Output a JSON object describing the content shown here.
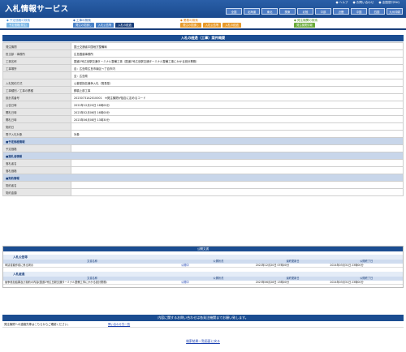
{
  "header": {
    "title": "入札情報サービス",
    "links": [
      "● ヘルプ",
      "● お問い合わせ",
      "● 全国窓口FAQ"
    ],
    "regions": [
      "全国",
      "北海道",
      "東北",
      "関東",
      "北陸",
      "中部",
      "近畿",
      "中国",
      "四国",
      "九州沖縄"
    ]
  },
  "nav": {
    "groups": [
      {
        "label": "◆ 予定価格の検索",
        "buttons": [
          "予定価格(発注)"
        ],
        "color": "#7bb7e6"
      },
      {
        "label": "◆ 工事の検索",
        "buttons": [
          "発注の見通し",
          "入札公告等",
          "入札の経過"
        ],
        "color": "#4a82c7"
      },
      {
        "label": "◆ 業務の検索",
        "buttons": [
          "発注の見通し",
          "入札公告等",
          "入札の経過"
        ],
        "color": "#e89a2a"
      },
      {
        "label": "◆ 発注機関の検索",
        "buttons": [
          "発注機関情報"
        ],
        "color": "#6aab3a"
      }
    ]
  },
  "page_title": "入札の経過（工事）案件概要",
  "info_rows": [
    {
      "label": "発注機関",
      "value": "国土交通省中国地方整備局"
    },
    {
      "label": "担当部・事務所",
      "value": "広島国道事務所"
    },
    {
      "label": "工事名称",
      "value": "国道2号広島駅交通ターミナル整備工事（国道2号広島駅交通ターミナル整備工事にかかる設計業務）"
    },
    {
      "label": "工事場所",
      "value": "自：広島県広島市南区～了自市内"
    },
    {
      "label": "",
      "value": "至：広島県"
    },
    {
      "label": "入札契約方式",
      "value": "公募型指名競争入札（簡易型）"
    },
    {
      "label": "工事種別／工事の業種",
      "value": "鋼橋上部工事"
    },
    {
      "label": "設計書番号",
      "value": "20230731A2010001　※発注機関が独自に定めるコード"
    },
    {
      "label": "公告日時",
      "value": "2022年12月20日 16時00分"
    },
    {
      "label": "開札日時",
      "value": "2023年02月06日 16時00分"
    },
    {
      "label": "開札日時",
      "value": "2023年06月08日 13時30分"
    },
    {
      "label": "契約日",
      "value": ""
    },
    {
      "label": "電子入札対象",
      "value": "対象"
    },
    {
      "label": "■予定価格情報",
      "value": "",
      "sub": true
    },
    {
      "label": "予定価格",
      "value": ""
    },
    {
      "label": "■落札者情報",
      "value": "",
      "sub": true
    },
    {
      "label": "落札者名",
      "value": ""
    },
    {
      "label": "落札価格",
      "value": ""
    },
    {
      "label": "■契約情報",
      "value": "",
      "sub": true
    },
    {
      "label": "契約者名",
      "value": ""
    },
    {
      "label": "契約金額",
      "value": ""
    }
  ],
  "docs": {
    "title": "公開文書",
    "sections": [
      {
        "title": "入札公告等",
        "columns": [
          "文書名称",
          "公開状況",
          "最終更新日",
          "公開終了日"
        ],
        "rows": [
          [
            "申請書類作成に係る掲示",
            "公開中",
            "2022年12月20日 07時00分",
            "2024年03月31日 23時00分"
          ]
        ]
      },
      {
        "title": "入札経過",
        "columns": [
          "文書名称",
          "公開状況",
          "最終更新日",
          "公開終了日"
        ],
        "rows": [
          [
            "競争参加結果及び契約の内容(国道2号広島駅交通ターミナル整備工事にかかる設計業務)",
            "公開中",
            "2023年06月28日 13時00分",
            "2024年03月31日 23時00分"
          ]
        ]
      }
    ]
  },
  "contact": {
    "title": "内容に関するお問い合わせは各発注機関までお願い致します。",
    "text": "発注機関への連絡先等はこちらからご確認ください。",
    "link": "問い合わせ先一覧"
  },
  "back_link": "検索結果一覧画面に戻る"
}
